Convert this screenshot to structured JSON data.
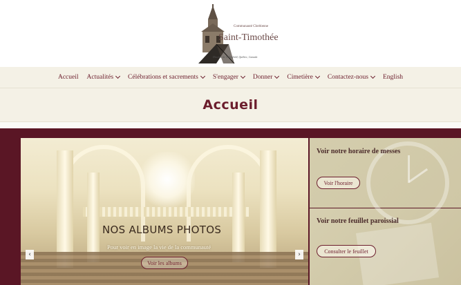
{
  "logo": {
    "community": "Communauté Chrétienne",
    "name": "Saint-Timothée",
    "location": "Diocèse de Valleyfield, Québec, Canada"
  },
  "nav": {
    "items": [
      {
        "label": "Accueil",
        "dropdown": false
      },
      {
        "label": "Actualités",
        "dropdown": true
      },
      {
        "label": "Célébrations et sacrements",
        "dropdown": true
      },
      {
        "label": "S'engager",
        "dropdown": true
      },
      {
        "label": "Donner",
        "dropdown": true
      },
      {
        "label": "Cimetière",
        "dropdown": true
      },
      {
        "label": "Contactez-nous",
        "dropdown": true
      },
      {
        "label": "English",
        "dropdown": false
      }
    ]
  },
  "page": {
    "title": "Accueil"
  },
  "slider": {
    "title": "NOS ALBUMS PHOTOS",
    "subtitle": "Pour voir en image la vie de la communauté",
    "button": "Voir les albums",
    "prev": "‹",
    "next": "›"
  },
  "panels": [
    {
      "title": "Voir notre horaire de messes",
      "button": "Voir l'horaire"
    },
    {
      "title": "Voir notre feuillet paroissial",
      "button": "Consulter le feuillet"
    }
  ],
  "colors": {
    "brand": "#6b1d2c",
    "nav_bg": "#f4f1e6",
    "feature_bg": "#5a1625"
  }
}
